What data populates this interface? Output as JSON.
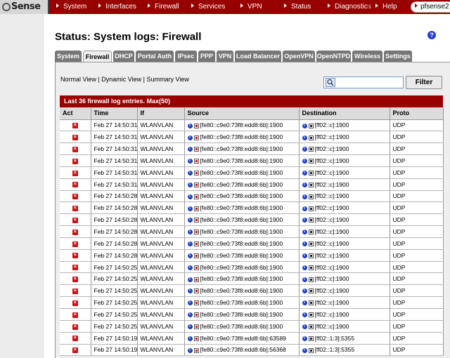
{
  "app": {
    "logo_text": "Sense",
    "host": "pfsense2"
  },
  "nav": [
    "System",
    "Interfaces",
    "Firewall",
    "Services",
    "VPN",
    "Status",
    "Diagnostics",
    "Help"
  ],
  "page_title": "Status: System logs: Firewall",
  "help_icon": "?",
  "tabs": [
    "System",
    "Firewall",
    "DHCP",
    "Portal Auth",
    "IPsec",
    "PPP",
    "VPN",
    "Load Balancer",
    "OpenVPN",
    "OpenNTPD",
    "Wireless",
    "Settings"
  ],
  "active_tab": "Firewall",
  "views": {
    "normal": "Normal View",
    "dynamic": "Dynamic View",
    "summary": "Summary View",
    "separator": "|"
  },
  "filter": {
    "placeholder": "",
    "button": "Filter"
  },
  "log": {
    "header": "Last 36 firewall log entries. Max(50)",
    "columns": [
      "Act",
      "Time",
      "If",
      "Source",
      "Destination",
      "Proto"
    ],
    "rows": [
      {
        "time": "Feb 27 14:50:31",
        "if": "WLANVLAN",
        "src": "[fe80::c9e0:73f8:edd8:6b]:1900",
        "dst": "[ff02::c]:1900",
        "proto": "UDP"
      },
      {
        "time": "Feb 27 14:50:31",
        "if": "WLANVLAN",
        "src": "[fe80::c9e0:73f8:edd8:6b]:1900",
        "dst": "[ff02::c]:1900",
        "proto": "UDP"
      },
      {
        "time": "Feb 27 14:50:31",
        "if": "WLANVLAN",
        "src": "[fe80::c9e0:73f8:edd8:6b]:1900",
        "dst": "[ff02::c]:1900",
        "proto": "UDP"
      },
      {
        "time": "Feb 27 14:50:31",
        "if": "WLANVLAN",
        "src": "[fe80::c9e0:73f8:edd8:6b]:1900",
        "dst": "[ff02::c]:1900",
        "proto": "UDP"
      },
      {
        "time": "Feb 27 14:50:31",
        "if": "WLANVLAN",
        "src": "[fe80::c9e0:73f8:edd8:6b]:1900",
        "dst": "[ff02::c]:1900",
        "proto": "UDP"
      },
      {
        "time": "Feb 27 14:50:31",
        "if": "WLANVLAN",
        "src": "[fe80::c9e0:73f8:edd8:6b]:1900",
        "dst": "[ff02::c]:1900",
        "proto": "UDP"
      },
      {
        "time": "Feb 27 14:50:28",
        "if": "WLANVLAN",
        "src": "[fe80::c9e0:73f8:edd8:6b]:1900",
        "dst": "[ff02::c]:1900",
        "proto": "UDP"
      },
      {
        "time": "Feb 27 14:50:28",
        "if": "WLANVLAN",
        "src": "[fe80::c9e0:73f8:edd8:6b]:1900",
        "dst": "[ff02::c]:1900",
        "proto": "UDP"
      },
      {
        "time": "Feb 27 14:50:28",
        "if": "WLANVLAN",
        "src": "[fe80::c9e0:73f8:edd8:6b]:1900",
        "dst": "[ff02::c]:1900",
        "proto": "UDP"
      },
      {
        "time": "Feb 27 14:50:28",
        "if": "WLANVLAN",
        "src": "[fe80::c9e0:73f8:edd8:6b]:1900",
        "dst": "[ff02::c]:1900",
        "proto": "UDP"
      },
      {
        "time": "Feb 27 14:50:28",
        "if": "WLANVLAN",
        "src": "[fe80::c9e0:73f8:edd8:6b]:1900",
        "dst": "[ff02::c]:1900",
        "proto": "UDP"
      },
      {
        "time": "Feb 27 14:50:28",
        "if": "WLANVLAN",
        "src": "[fe80::c9e0:73f8:edd8:6b]:1900",
        "dst": "[ff02::c]:1900",
        "proto": "UDP"
      },
      {
        "time": "Feb 27 14:50:25",
        "if": "WLANVLAN",
        "src": "[fe80::c9e0:73f8:edd8:6b]:1900",
        "dst": "[ff02::c]:1900",
        "proto": "UDP"
      },
      {
        "time": "Feb 27 14:50:25",
        "if": "WLANVLAN",
        "src": "[fe80::c9e0:73f8:edd8:6b]:1900",
        "dst": "[ff02::c]:1900",
        "proto": "UDP"
      },
      {
        "time": "Feb 27 14:50:25",
        "if": "WLANVLAN",
        "src": "[fe80::c9e0:73f8:edd8:6b]:1900",
        "dst": "[ff02::c]:1900",
        "proto": "UDP"
      },
      {
        "time": "Feb 27 14:50:25",
        "if": "WLANVLAN",
        "src": "[fe80::c9e0:73f8:edd8:6b]:1900",
        "dst": "[ff02::c]:1900",
        "proto": "UDP"
      },
      {
        "time": "Feb 27 14:50:25",
        "if": "WLANVLAN",
        "src": "[fe80::c9e0:73f8:edd8:6b]:1900",
        "dst": "[ff02::c]:1900",
        "proto": "UDP"
      },
      {
        "time": "Feb 27 14:50:25",
        "if": "WLANVLAN",
        "src": "[fe80::c9e0:73f8:edd8:6b]:1900",
        "dst": "[ff02::c]:1900",
        "proto": "UDP"
      },
      {
        "time": "Feb 27 14:50:19",
        "if": "WLANVLAN",
        "src": "[fe80::c9e0:73f8:edd8:6b]:63589",
        "dst": "[ff02::1:3]:5355",
        "proto": "UDP"
      },
      {
        "time": "Feb 27 14:50:19",
        "if": "WLANVLAN",
        "src": "[fe80::c9e0:73f8:edd8:6b]:56368",
        "dst": "[ff02::1:3]:5355",
        "proto": "UDP"
      }
    ]
  },
  "colors": {
    "brand": "#990000",
    "tab_inactive": "#777777",
    "block_icon": "#cc1111",
    "info_icon": "#1f3fbf"
  }
}
